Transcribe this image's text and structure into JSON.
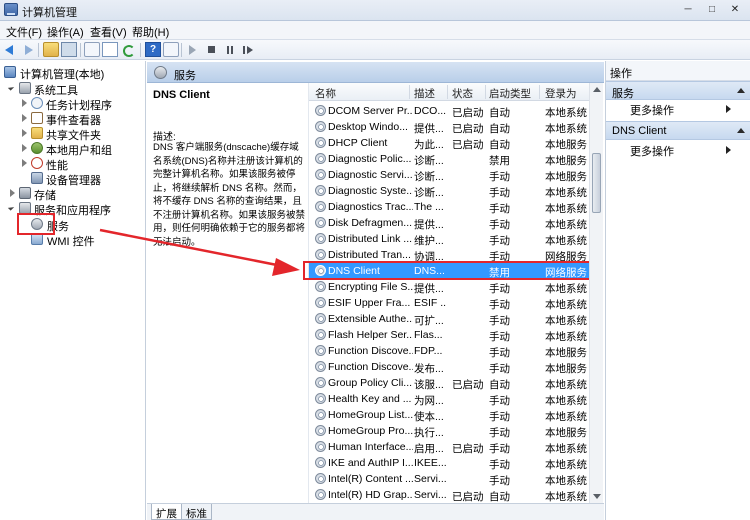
{
  "window": {
    "title": "计算机管理"
  },
  "menu": [
    "文件(F)",
    "操作(A)",
    "查看(V)",
    "帮助(H)"
  ],
  "tree": {
    "root": "计算机管理(本地)",
    "system_tools": "系统工具",
    "task_scheduler": "任务计划程序",
    "event_viewer": "事件查看器",
    "shared_folders": "共享文件夹",
    "local_users": "本地用户和组",
    "performance": "性能",
    "device_manager": "设备管理器",
    "storage": "存储",
    "services_apps": "服务和应用程序",
    "services": "服务",
    "wmi": "WMI 控件"
  },
  "services_panel": {
    "header": "服务",
    "selected_name": "DNS Client",
    "desc_label": "描述:",
    "desc_text": "DNS 客户端服务(dnscache)缓存域名系统(DNS)名称并注册该计算机的完整计算机名称。如果该服务被停止，将继续解析 DNS 名称。然而，将不缓存 DNS 名称的查询结果，且不注册计算机名称。如果该服务被禁用，则任何明确依赖于它的服务都将无法启动。"
  },
  "columns": {
    "name": "名称",
    "desc": "描述",
    "state": "状态",
    "start": "启动类型",
    "logon": "登录为"
  },
  "rows": [
    {
      "name": "DCOM Server Pr...",
      "desc": "DCO...",
      "state": "已启动",
      "start": "自动",
      "logon": "本地系统"
    },
    {
      "name": "Desktop Windo...",
      "desc": "提供...",
      "state": "已启动",
      "start": "自动",
      "logon": "本地系统"
    },
    {
      "name": "DHCP Client",
      "desc": "为此...",
      "state": "已启动",
      "start": "自动",
      "logon": "本地服务"
    },
    {
      "name": "Diagnostic Polic...",
      "desc": "诊断...",
      "state": "",
      "start": "禁用",
      "logon": "本地服务"
    },
    {
      "name": "Diagnostic Servi...",
      "desc": "诊断...",
      "state": "",
      "start": "手动",
      "logon": "本地服务"
    },
    {
      "name": "Diagnostic Syste...",
      "desc": "诊断...",
      "state": "",
      "start": "手动",
      "logon": "本地系统"
    },
    {
      "name": "Diagnostics Trac...",
      "desc": "The ...",
      "state": "",
      "start": "手动",
      "logon": "本地系统"
    },
    {
      "name": "Disk Defragmen...",
      "desc": "提供...",
      "state": "",
      "start": "手动",
      "logon": "本地系统"
    },
    {
      "name": "Distributed Link ...",
      "desc": "维护...",
      "state": "",
      "start": "手动",
      "logon": "本地系统"
    },
    {
      "name": "Distributed Tran...",
      "desc": "协调...",
      "state": "",
      "start": "手动",
      "logon": "网络服务"
    },
    {
      "name": "DNS Client",
      "desc": "DNS...",
      "state": "",
      "start": "禁用",
      "logon": "网络服务"
    },
    {
      "name": "Encrypting File S...",
      "desc": "提供...",
      "state": "",
      "start": "手动",
      "logon": "本地系统"
    },
    {
      "name": "ESIF Upper Fra...",
      "desc": "ESIF ...",
      "state": "",
      "start": "手动",
      "logon": "本地系统"
    },
    {
      "name": "Extensible Authe...",
      "desc": "可扩...",
      "state": "",
      "start": "手动",
      "logon": "本地系统"
    },
    {
      "name": "Flash Helper Ser...",
      "desc": "Flas...",
      "state": "",
      "start": "手动",
      "logon": "本地系统"
    },
    {
      "name": "Function Discove...",
      "desc": "FDP...",
      "state": "",
      "start": "手动",
      "logon": "本地服务"
    },
    {
      "name": "Function Discove...",
      "desc": "发布...",
      "state": "",
      "start": "手动",
      "logon": "本地服务"
    },
    {
      "name": "Group Policy Cli...",
      "desc": "该服...",
      "state": "已启动",
      "start": "自动",
      "logon": "本地系统"
    },
    {
      "name": "Health Key and ...",
      "desc": "为网...",
      "state": "",
      "start": "手动",
      "logon": "本地系统"
    },
    {
      "name": "HomeGroup List...",
      "desc": "使本...",
      "state": "",
      "start": "手动",
      "logon": "本地系统"
    },
    {
      "name": "HomeGroup Pro...",
      "desc": "执行...",
      "state": "",
      "start": "手动",
      "logon": "本地服务"
    },
    {
      "name": "Human Interface...",
      "desc": "启用...",
      "state": "已启动",
      "start": "手动",
      "logon": "本地系统"
    },
    {
      "name": "IKE and AuthIP I...",
      "desc": "IKEE...",
      "state": "",
      "start": "手动",
      "logon": "本地系统"
    },
    {
      "name": "Intel(R) Content ...",
      "desc": "Servi...",
      "state": "",
      "start": "手动",
      "logon": "本地系统"
    },
    {
      "name": "Intel(R) HD Grap...",
      "desc": "Servi...",
      "state": "已启动",
      "start": "自动",
      "logon": "本地系统"
    }
  ],
  "tabs": [
    "扩展",
    "标准"
  ],
  "actions": {
    "title": "操作",
    "sec1": "服务",
    "sec1_more": "更多操作",
    "sec2": "DNS Client",
    "sec2_more": "更多操作"
  }
}
